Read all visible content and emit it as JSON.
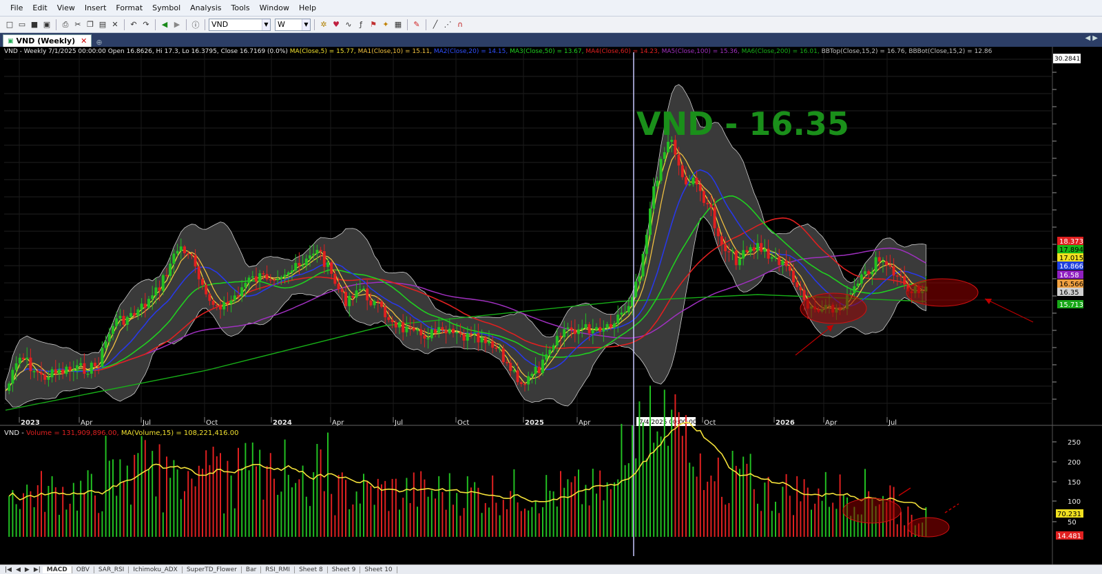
{
  "menu": [
    "File",
    "Edit",
    "View",
    "Insert",
    "Format",
    "Symbol",
    "Analysis",
    "Tools",
    "Window",
    "Help"
  ],
  "toolbar": {
    "symbol": "VND",
    "interval": "W"
  },
  "tab": {
    "title": "VND (Weekly)",
    "close": "✕"
  },
  "price_header": {
    "text1": "VND - Weekly 7/1/2025 00:00:00 Open 16.8626, Hi 17.3, Lo 16.3795, Close 16.7169 (0.0%) ",
    "ma5": "MA(Close,5) = 15.77, ",
    "ma10": "MA1(Close,10) = 15.11, ",
    "ma20": "MA2(Close,20) = 14.15, ",
    "ma50": "MA3(Close,50) = 13.67, ",
    "ma60": "MA4(Close,60) = 14.23, ",
    "ma100": "MA5(Close,100) = 15.36, ",
    "ma200": "MA6(Close,200) = 16.01, ",
    "bbtop": "BBTop(Close,15,2) = 16.76, ",
    "bbbot": "BBBot(Close,15,2) = 12.86"
  },
  "overlay_title": "VND - 16.35",
  "price_axis_top": "30.2841",
  "price_tags": [
    {
      "text": "18.373",
      "bg": "#e02020",
      "fg": "#ffffff"
    },
    {
      "text": "17.894",
      "bg": "#18b818",
      "fg": "#000000"
    },
    {
      "text": "17.015",
      "bg": "#f0e020",
      "fg": "#000000"
    },
    {
      "text": "16.866",
      "bg": "#2040e0",
      "fg": "#ffffff"
    },
    {
      "text": "16.58",
      "bg": "#9020c0",
      "fg": "#ffffff"
    },
    {
      "text": "16.566",
      "bg": "#f0a040",
      "fg": "#000000"
    },
    {
      "text": "16.35",
      "bg": "#d0d0d0",
      "fg": "#000000"
    },
    {
      "text": "15.713",
      "bg": "#18a818",
      "fg": "#ffffff"
    }
  ],
  "time_labels": [
    "2023",
    "Apr",
    "Jul",
    "Oct",
    "2024",
    "Apr",
    "Jul",
    "Oct",
    "2025",
    "Apr",
    "Oct",
    "2026",
    "Apr",
    "Jul"
  ],
  "cursor_time": "7/4/2025 00:00:00",
  "volume_header": {
    "prefix": "VND - ",
    "vol": "Volume = 131,909,896.00, ",
    "ma": "MA(Volume,15) = 108,221,416.00"
  },
  "volume_axis": [
    "250",
    "200",
    "150",
    "100",
    "50"
  ],
  "volume_tags": [
    {
      "text": "70.231",
      "bg": "#f0e020",
      "fg": "#000000"
    },
    {
      "text": "14.481",
      "bg": "#e02020",
      "fg": "#ffffff"
    }
  ],
  "sheets": [
    "MACD",
    "OBV",
    "SAR_RSI",
    "Ichimoku_ADX",
    "SuperTD_Flower",
    "Bar",
    "RSI_RMI",
    "Sheet 8",
    "Sheet 9",
    "Sheet 10"
  ],
  "colors": {
    "up": "#22c022",
    "down": "#e02020",
    "bb": "#3a3a3a",
    "ma5": "#f5e23a",
    "ma10": "#f0c040",
    "ma20": "#2838e8",
    "ma50": "#20d020",
    "ma100": "#e02020",
    "ma200": "#a030c0",
    "ma300": "#18b018",
    "volma": "#f5e23a",
    "annot": "#c00000"
  }
}
